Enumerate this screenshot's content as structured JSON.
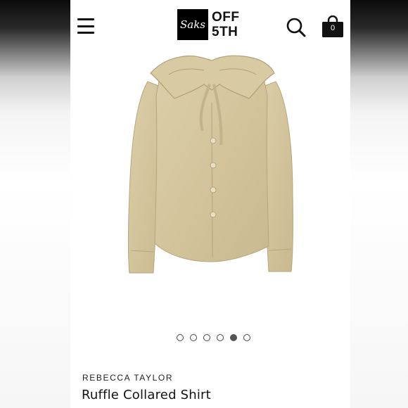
{
  "header": {
    "logo_mark": "Saks",
    "logo_line1": "OFF",
    "logo_line2": "5TH",
    "bag_count": "0"
  },
  "icons": {
    "menu": "hamburger-menu-icon",
    "search": "search-icon",
    "bag": "shopping-bag-icon"
  },
  "carousel": {
    "total": 6,
    "active_index": 4
  },
  "product": {
    "brand": "REBECCA TAYLOR",
    "name": "Ruffle Collared Shirt",
    "color": "#d3c49c"
  }
}
